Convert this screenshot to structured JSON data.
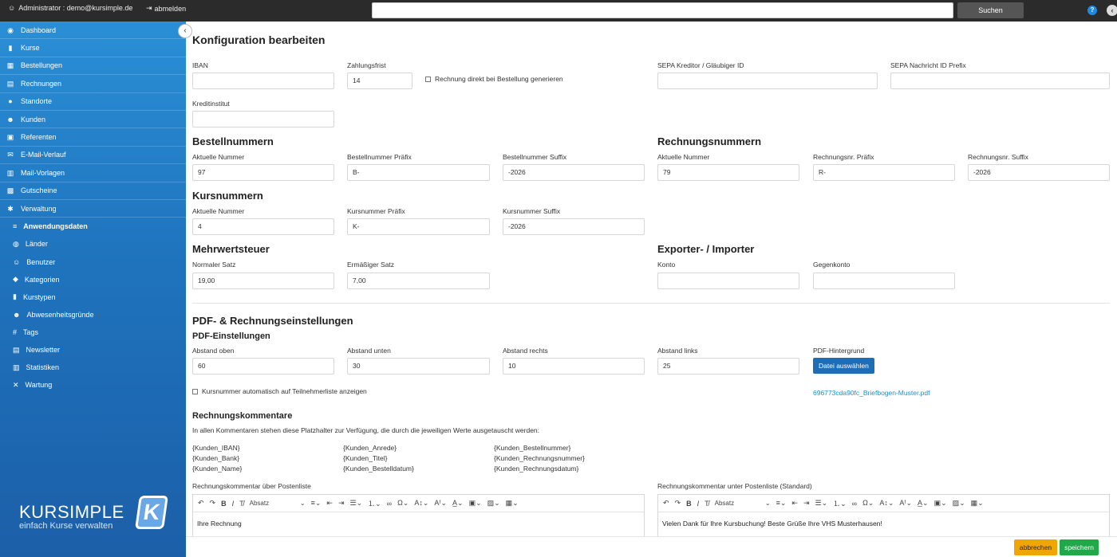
{
  "topbar": {
    "user": "Administrator : demo@kursimple.de",
    "logout": "abmelden",
    "search_placeholder": "",
    "search_button": "Suchen",
    "help": "?",
    "collapse": "‹"
  },
  "sidebar": {
    "toggle": "‹",
    "items": [
      {
        "label": "Dashboard",
        "icon": "dashboard-icon",
        "glyph": "◉"
      },
      {
        "label": "Kurse",
        "icon": "book-icon",
        "glyph": "▮"
      },
      {
        "label": "Bestellungen",
        "icon": "cart-icon",
        "glyph": "▦"
      },
      {
        "label": "Rechnungen",
        "icon": "invoice-icon",
        "glyph": "▤"
      },
      {
        "label": "Standorte",
        "icon": "map-marker-icon",
        "glyph": "●"
      },
      {
        "label": "Kunden",
        "icon": "users-icon",
        "glyph": "☻"
      },
      {
        "label": "Referenten",
        "icon": "chalkboard-icon",
        "glyph": "▣"
      },
      {
        "label": "E-Mail-Verlauf",
        "icon": "envelope-icon",
        "glyph": "✉"
      },
      {
        "label": "Mail-Vorlagen",
        "icon": "template-icon",
        "glyph": "▥"
      },
      {
        "label": "Gutscheine",
        "icon": "gift-icon",
        "glyph": "▩"
      },
      {
        "label": "Verwaltung",
        "icon": "gear-icon",
        "glyph": "✱"
      }
    ],
    "sub_items": [
      {
        "label": "Anwendungsdaten",
        "icon": "database-icon",
        "glyph": "≡",
        "active": true
      },
      {
        "label": "Länder",
        "icon": "globe-icon",
        "glyph": "◍"
      },
      {
        "label": "Benutzer",
        "icon": "user-icon",
        "glyph": "☺"
      },
      {
        "label": "Kategorien",
        "icon": "tags-icon",
        "glyph": "◆"
      },
      {
        "label": "Kurstypen",
        "icon": "bookmark-icon",
        "glyph": "▮"
      },
      {
        "label": "Abwesenheitsgründe",
        "icon": "user-minus-icon",
        "glyph": "☻"
      },
      {
        "label": "Tags",
        "icon": "hashtag-icon",
        "glyph": "#"
      },
      {
        "label": "Newsletter",
        "icon": "newspaper-icon",
        "glyph": "▤"
      },
      {
        "label": "Statistiken",
        "icon": "chart-icon",
        "glyph": "▥"
      },
      {
        "label": "Wartung",
        "icon": "wrench-icon",
        "glyph": "✕"
      }
    ],
    "logo_brand": "KURSIMPLE",
    "logo_tagline": "einfach Kurse verwalten",
    "logo_mark": "K"
  },
  "page": {
    "title": "Konfiguration bearbeiten",
    "iban_label": "IBAN",
    "iban_value": "",
    "zahlungsfrist_label": "Zahlungsfrist",
    "zahlungsfrist_value": "14",
    "rechnung_direkt_label": "Rechnung direkt bei Bestellung generieren",
    "sepa_creditor_label": "SEPA Kreditor / Gläubiger ID",
    "sepa_creditor_value": "",
    "sepa_prefix_label": "SEPA Nachricht ID Prefix",
    "sepa_prefix_value": "",
    "kreditinstitut_label": "Kreditinstitut",
    "kreditinstitut_value": "",
    "bestellnummern": {
      "heading": "Bestellnummern",
      "current_label": "Aktuelle Nummer",
      "current_value": "97",
      "prefix_label": "Bestellnummer Präfix",
      "prefix_value": "B-",
      "suffix_label": "Bestellnummer Suffix",
      "suffix_value": "-2026"
    },
    "rechnungsnummern": {
      "heading": "Rechnungsnummern",
      "current_label": "Aktuelle Nummer",
      "current_value": "79",
      "prefix_label": "Rechnungsnr. Präfix",
      "prefix_value": "R-",
      "suffix_label": "Rechnungsnr. Suffix",
      "suffix_value": "-2026"
    },
    "kursnummern": {
      "heading": "Kursnummern",
      "current_label": "Aktuelle Nummer",
      "current_value": "4",
      "prefix_label": "Kursnummer Präfix",
      "prefix_value": "K-",
      "suffix_label": "Kursnummer Suffix",
      "suffix_value": "-2026"
    },
    "mwst": {
      "heading": "Mehrwertsteuer",
      "normal_label": "Normaler Satz",
      "normal_value": "19,00",
      "reduced_label": "Ermäßiger Satz",
      "reduced_value": "7,00"
    },
    "exporter": {
      "heading": "Exporter- / Importer",
      "konto_label": "Konto",
      "konto_value": "",
      "gegenkonto_label": "Gegenkonto",
      "gegenkonto_value": ""
    },
    "pdf": {
      "heading": "PDF- & Rechnungseinstellungen",
      "subheading": "PDF-Einstellungen",
      "oben_label": "Abstand oben",
      "oben_value": "60",
      "unten_label": "Abstand unten",
      "unten_value": "30",
      "rechts_label": "Abstand rechts",
      "rechts_value": "10",
      "links_label": "Abstand links",
      "links_value": "25",
      "bg_label": "PDF-Hintergrund",
      "bg_button": "Datei auswählen",
      "bg_file": "696773cda90fc_Briefbogen-Muster.pdf",
      "kursnummer_checkbox": "Kursnummer automatisch auf Teilnehmerliste anzeigen"
    },
    "kommentare": {
      "heading": "Rechnungskommentare",
      "intro": "In allen Kommentaren stehen diese Platzhalter zur Verfügung, die durch die jeweiligen Werte ausgetauscht werden:",
      "placeholders_col1": [
        "{Kunden_IBAN}",
        "{Kunden_Bank}",
        "{Kunden_Name}"
      ],
      "placeholders_col2": [
        "{Kunden_Anrede}",
        "{Kunden_Titel}",
        "{Kunden_Bestelldatum}"
      ],
      "placeholders_col3": [
        "{Kunden_Bestellnummer}",
        "{Kunden_Rechnungsnummer}",
        "{Kunden_Rechnungsdatum}"
      ],
      "above_label": "Rechnungskommentar über Postenliste",
      "above_text": "Ihre Rechnung",
      "below_label": "Rechnungskommentar unter Postenliste (Standard)",
      "below_text": "Vielen Dank für Ihre Kursbuchung! Beste Grüße Ihre VHS Musterhausen!",
      "format_label": "Absatz"
    }
  },
  "footer": {
    "cancel": "abbrechen",
    "save": "speichern"
  },
  "colors": {
    "sidebar": "#1f73bd",
    "primary_button": "#1f6db5",
    "cancel_button": "#f0a500",
    "save_button": "#21a84a",
    "link": "#1f8fc6"
  }
}
